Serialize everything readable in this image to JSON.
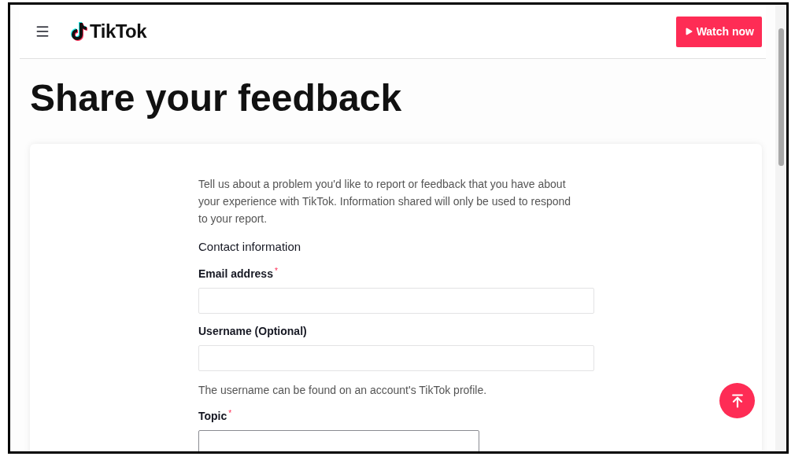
{
  "header": {
    "logo": "TikTok",
    "action_button": "Watch now"
  },
  "page_title": "Share your feedback",
  "form": {
    "intro": "Tell us about a problem you'd like to report or feedback that you have about your experience with TikTok. Information shared will only be used to respond to your report.",
    "section_title": "Contact information",
    "fields": [
      {
        "kind": "text",
        "label": "Email address",
        "required_mark": "*"
      },
      {
        "kind": "text",
        "label": "Username (Optional)",
        "hint": "The username can be found on an account's TikTok profile."
      },
      {
        "kind": "select",
        "label": "Topic",
        "required_mark": "*"
      }
    ]
  }
}
